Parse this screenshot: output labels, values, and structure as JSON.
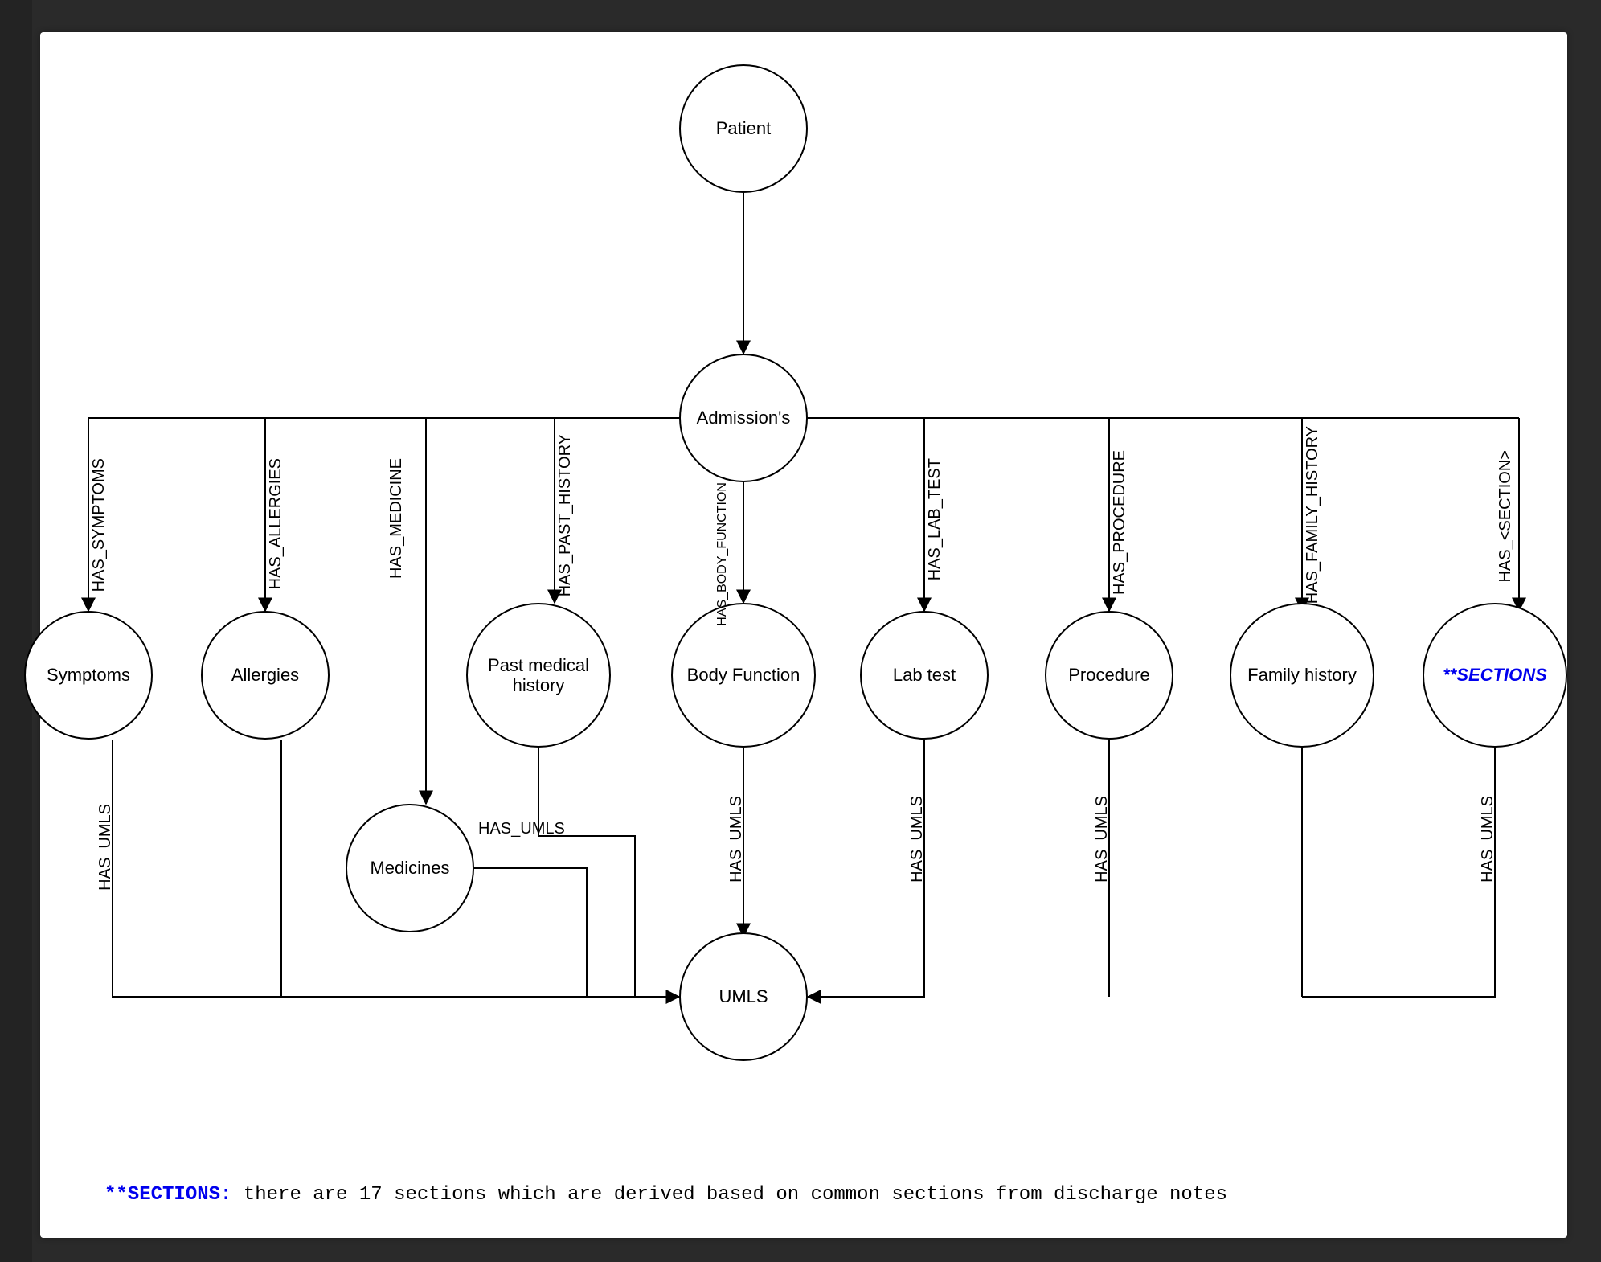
{
  "diagram": {
    "nodes": {
      "patient": "Patient",
      "admissions": "Admission's",
      "symptoms": "Symptoms",
      "allergies": "Allergies",
      "past_medical_history": "Past medical history",
      "body_function": "Body Function",
      "lab_test": "Lab test",
      "procedure": "Procedure",
      "family_history": "Family history",
      "sections": "**SECTIONS",
      "medicines": "Medicines",
      "umls": "UMLS"
    },
    "edges": {
      "has_symptoms": "HAS_SYMPTOMS",
      "has_allergies": "HAS_ALLERGIES",
      "has_medicine": "HAS_MEDICINE",
      "has_past_history": "HAS_PAST_HISTORY",
      "has_body_function": "HAS_BODY_FUNCTION",
      "has_lab_test": "HAS_LAB_TEST",
      "has_procedure": "HAS_PROCEDURE",
      "has_family_history": "HAS_FAMILY_HISTORY",
      "has_section": "HAS_<SECTION>",
      "has_umls_symptoms": "HAS_UMLS",
      "has_umls_medicines": "HAS_UMLS",
      "has_umls_body": "HAS_UMLS",
      "has_umls_lab": "HAS_UMLS",
      "has_umls_procedure": "HAS_UMLS",
      "has_umls_sections": "HAS_UMLS"
    },
    "footnote": {
      "lead": "**SECTIONS:",
      "text": " there are 17 sections which are derived based on common sections from discharge notes"
    }
  }
}
